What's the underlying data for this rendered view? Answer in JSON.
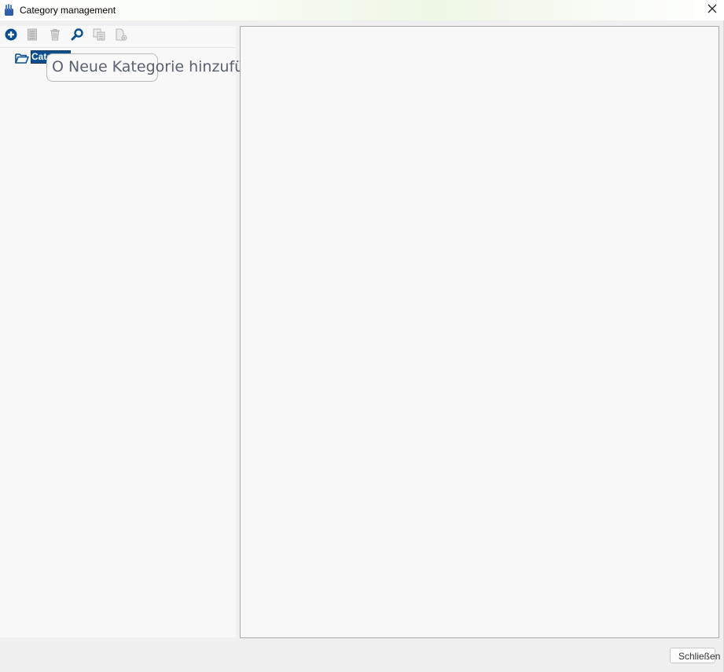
{
  "window": {
    "title": "Category management",
    "icon": "app-hand-icon",
    "close_icon": "close-icon"
  },
  "toolbar": {
    "buttons": [
      {
        "name": "add-category-button",
        "icon": "plus-circle-icon",
        "enabled": true
      },
      {
        "name": "edit-button",
        "icon": "document-list-icon",
        "enabled": false
      },
      {
        "name": "delete-button",
        "icon": "trash-icon",
        "enabled": false
      },
      {
        "name": "search-button",
        "icon": "magnifier-icon",
        "enabled": true
      },
      {
        "name": "copy-button",
        "icon": "copy-icon",
        "enabled": false
      },
      {
        "name": "properties-button",
        "icon": "document-settings-icon",
        "enabled": false
      }
    ]
  },
  "tree": {
    "root": {
      "label": "Cate",
      "icon": "folder-open-icon",
      "selected": true
    }
  },
  "tooltip": {
    "text": "O Neue Kategorie hinzufügen"
  },
  "footer": {
    "close_label": "Schließen"
  },
  "colors": {
    "accent": "#0a4f8f",
    "icon_active": "#0a4f8f",
    "icon_disabled": "#b4b4b4"
  }
}
